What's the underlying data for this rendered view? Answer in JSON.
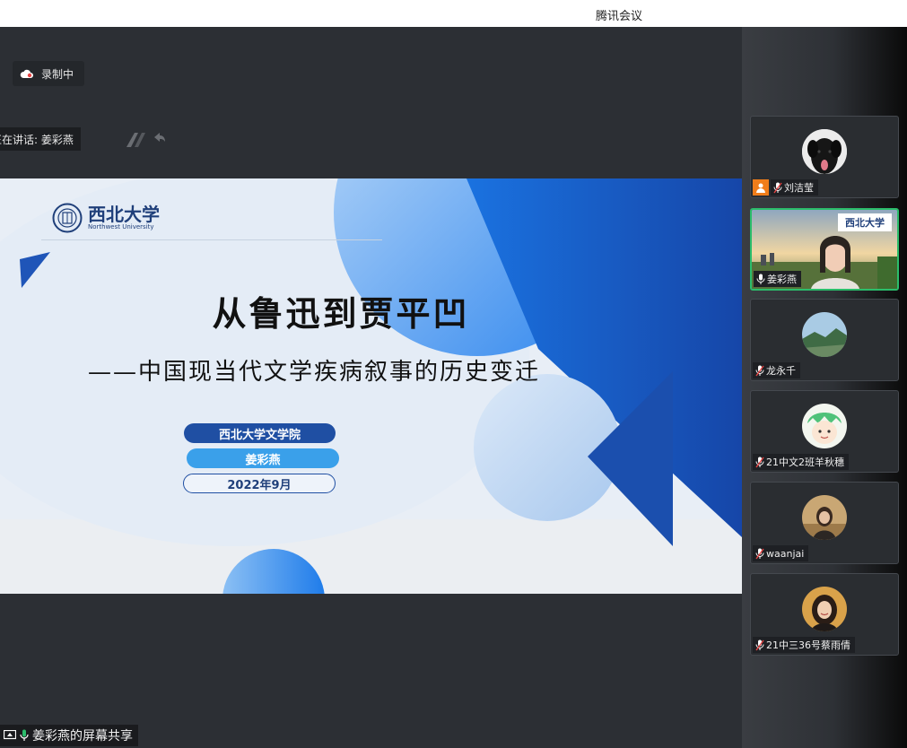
{
  "titlebar": {
    "app_title": "腾讯会议"
  },
  "recording": {
    "label": "录制中",
    "icon": "cloud-icon"
  },
  "speaking": {
    "label": "正在讲话: 姜彩燕"
  },
  "slide": {
    "logo_cn": "西北大学",
    "logo_en": "Northwest University",
    "title": "从鲁迅到贾平凹",
    "subtitle": "——中国现当代文学疾病叙事的历史变迁",
    "school": "西北大学文学院",
    "author": "姜彩燕",
    "date": "2022年9月"
  },
  "participants": [
    {
      "name": "刘洁莹",
      "mic": "muted",
      "host": true
    },
    {
      "name": "姜彩燕",
      "mic": "active",
      "active": true
    },
    {
      "name": "龙永千",
      "mic": "muted"
    },
    {
      "name": "21中文2班羊秋穗",
      "mic": "muted"
    },
    {
      "name": "waanjai",
      "mic": "muted"
    },
    {
      "name": "21中三36号蔡雨倩",
      "mic": "muted"
    }
  ],
  "share": {
    "label": "姜彩燕的屏幕共享"
  },
  "colors": {
    "active_border": "#2bbd6b",
    "host_badge": "#f07d1a",
    "slide_blue": "#1f4fa3"
  }
}
